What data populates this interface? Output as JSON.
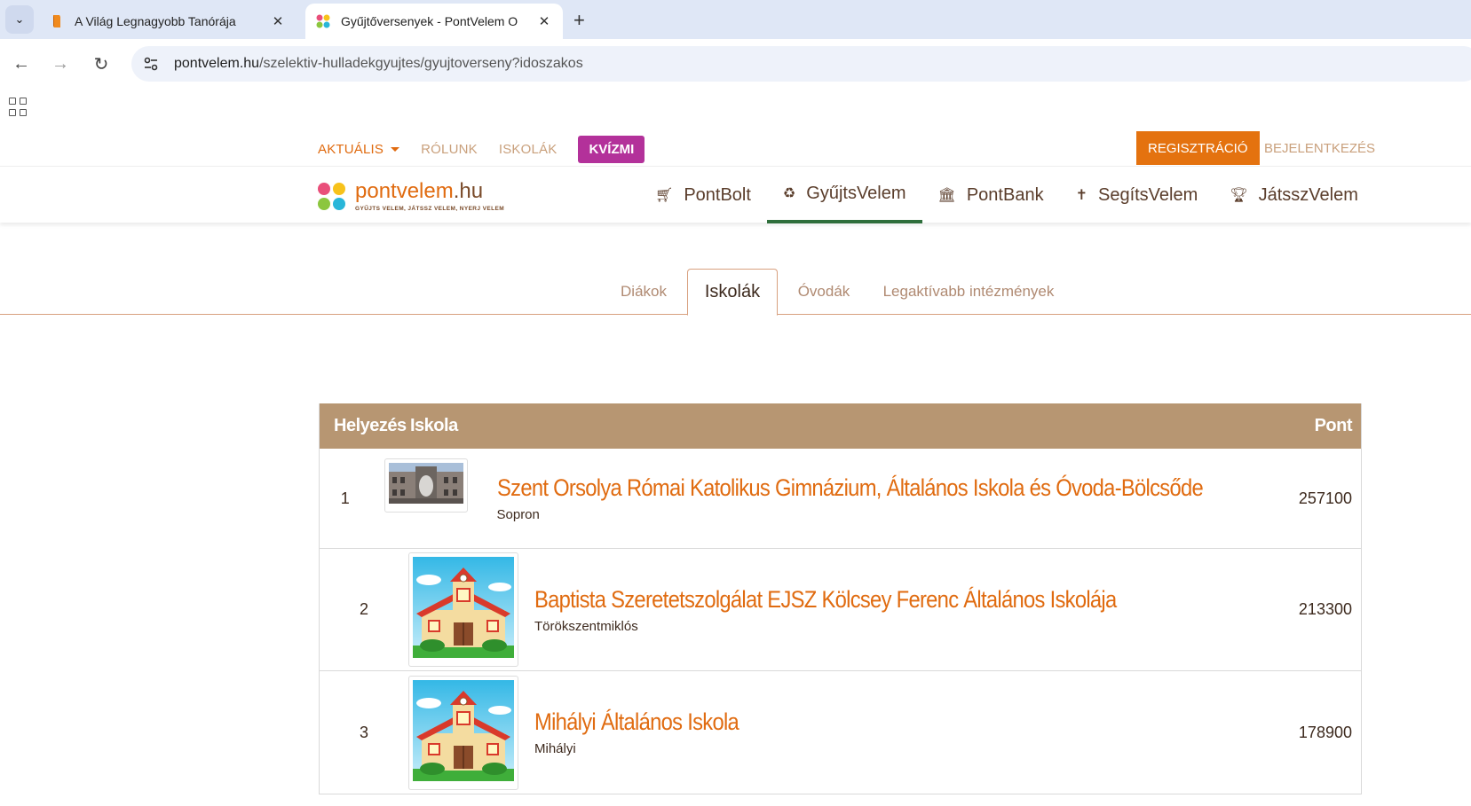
{
  "browser": {
    "tabs": [
      {
        "title": "A Világ Legnagyobb Tanórája",
        "active": false
      },
      {
        "title": "Gyűjtőversenyek - PontVelem O",
        "active": true
      }
    ],
    "url_host": "pontvelem.hu",
    "url_path": "/szelektiv-hulladekgyujtes/gyujtoverseny?idoszakos"
  },
  "topnav": {
    "items": [
      "AKTUÁLIS",
      "RÓLUNK",
      "ISKOLÁK"
    ],
    "kvizmi": "KVÍZMI",
    "register": "REGISZTRÁCIÓ",
    "login": "BEJELENTKEZÉS"
  },
  "logo": {
    "brand": "pontvelem",
    "tld": ".hu",
    "tagline": "GYŰJTS VELEM, JÁTSSZ VELEM, NYERJ VELEM"
  },
  "mainnav": [
    {
      "label": "PontBolt",
      "icon": "cart-icon"
    },
    {
      "label": "GyűjtsVelem",
      "icon": "recycle-icon",
      "active": true
    },
    {
      "label": "PontBank",
      "icon": "bank-icon"
    },
    {
      "label": "SegítsVelem",
      "icon": "person-icon"
    },
    {
      "label": "JátsszVelem",
      "icon": "trophy-icon"
    }
  ],
  "subtabs": [
    "Diákok",
    "Iskolák",
    "Óvodák",
    "Legaktívabb intézmények"
  ],
  "table": {
    "headers": {
      "rank": "Helyezés",
      "school": "Iskola",
      "points": "Pont"
    },
    "rows": [
      {
        "rank": "1",
        "name": "Szent Orsolya Római Katolikus Gimnázium, Általános Iskola és Óvoda-Bölcsőde",
        "city": "Sopron",
        "points": "257100",
        "image": "photo"
      },
      {
        "rank": "2",
        "name": "Baptista Szeretetszolgálat EJSZ Kölcsey Ferenc Általános Iskolája",
        "city": "Törökszentmiklós",
        "points": "213300",
        "image": "school-illustration"
      },
      {
        "rank": "3",
        "name": "Mihályi Általános Iskola",
        "city": "Mihályi",
        "points": "178900",
        "image": "school-illustration"
      }
    ]
  },
  "colors": {
    "accent": "#e06b10",
    "kvizmi": "#b3319a",
    "table_header": "#b79672",
    "active_underline": "#2f6f3c"
  }
}
